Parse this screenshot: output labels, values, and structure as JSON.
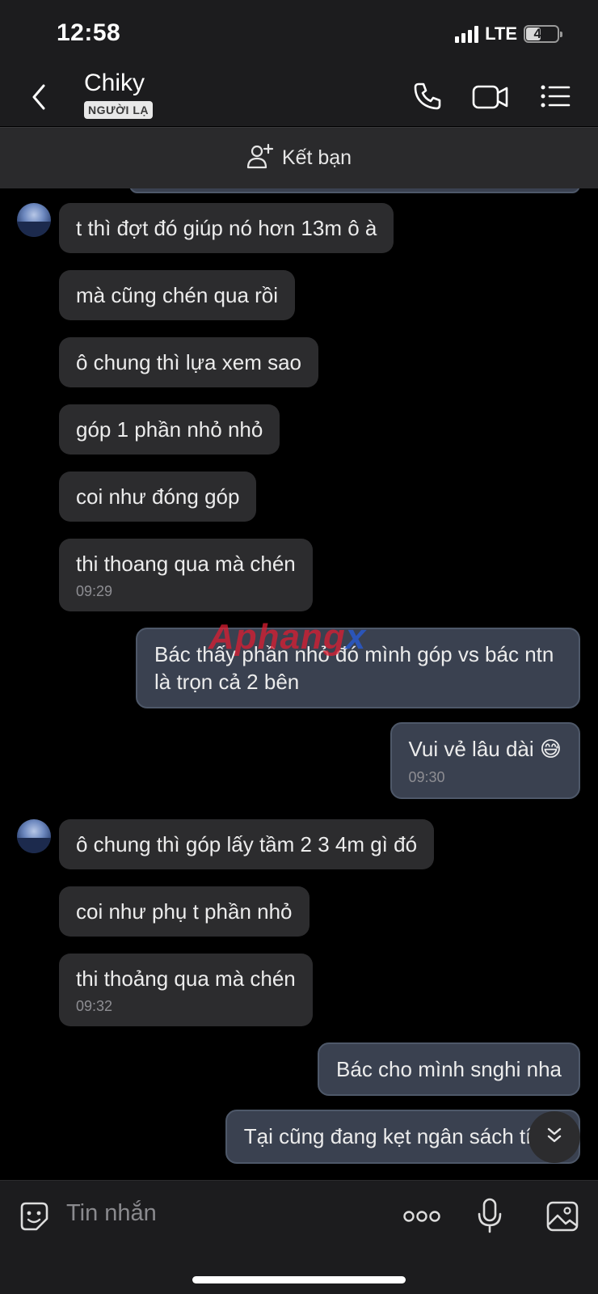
{
  "status_bar": {
    "time": "12:58",
    "network": "LTE",
    "battery": "47"
  },
  "header": {
    "contact_name": "Chiky",
    "badge": "NGƯỜI LẠ",
    "icons": [
      "back-icon",
      "phone-icon",
      "video-call-icon",
      "menu-list-icon"
    ]
  },
  "add_friend": {
    "label": "Kết bạn",
    "icon": "add-person-icon"
  },
  "watermark": {
    "part1": "Aphang",
    "part2": "x"
  },
  "messages": [
    {
      "from": "them",
      "text": "t thì đợt đó giúp nó hơn 13m ô à"
    },
    {
      "from": "them",
      "text": "mà cũng chén qua rồi"
    },
    {
      "from": "them",
      "text": "ô chung thì lựa xem sao"
    },
    {
      "from": "them",
      "text": "góp 1 phần nhỏ nhỏ"
    },
    {
      "from": "them",
      "text": "coi như đóng góp"
    },
    {
      "from": "them",
      "text": "thi thoang qua mà chén",
      "time": "09:29"
    },
    {
      "from": "me",
      "text": "Bác thấy phần nhỏ đó mình góp vs bác ntn là trọn cả 2 bên"
    },
    {
      "from": "me",
      "text": "Vui vẻ lâu dài",
      "emoji": "😅",
      "time": "09:30"
    },
    {
      "from": "them",
      "text": "ô chung thì góp lấy tầm 2 3 4m gì đó"
    },
    {
      "from": "them",
      "text": "coi như phụ t phần nhỏ"
    },
    {
      "from": "them",
      "text": "thi thoảng qua mà chén",
      "time": "09:32"
    },
    {
      "from": "me",
      "text": "Bác cho mình snghi nha"
    },
    {
      "from": "me",
      "text": "Tại cũng đang kẹt ngân sách tí",
      "emoji": "😂"
    }
  ],
  "composer": {
    "placeholder": "Tin nhắn",
    "icons": [
      "sticker-icon",
      "more-options-icon",
      "microphone-icon",
      "image-icon"
    ]
  }
}
